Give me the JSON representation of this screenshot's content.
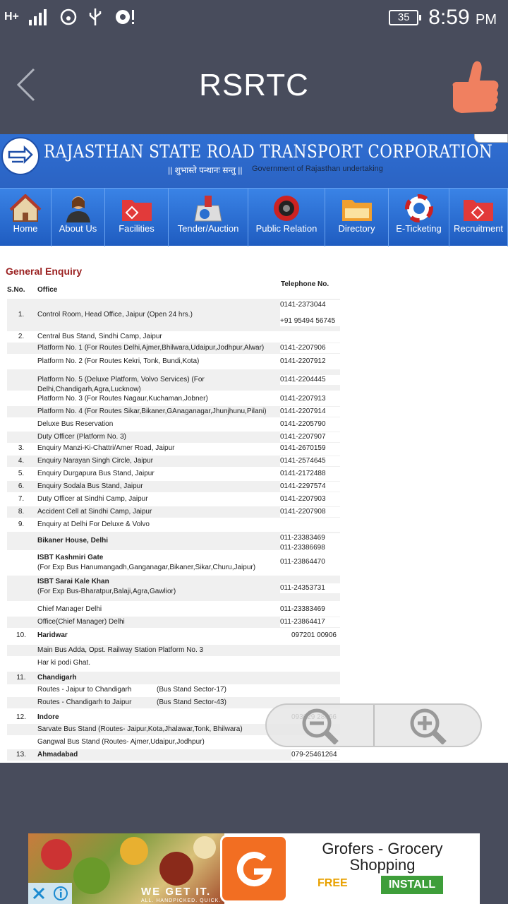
{
  "status_bar": {
    "network": "H+",
    "battery": "35",
    "time": "8:59",
    "ampm": "PM"
  },
  "app_bar": {
    "title": "RSRTC"
  },
  "site": {
    "corp_name": "RAJASTHAN STATE ROAD TRANSPORT CORPORATION",
    "motto": "|| शुभास्ते पन्थानः सन्तु ||",
    "govt": "Government of Rajasthan undertaking",
    "nav": [
      {
        "label": "Home"
      },
      {
        "label": "About Us"
      },
      {
        "label": "Facilities"
      },
      {
        "label": "Tender/Auction"
      },
      {
        "label": "Public Relation"
      },
      {
        "label": "Directory"
      },
      {
        "label": "E-Ticketing"
      },
      {
        "label": "Recruitment"
      }
    ]
  },
  "enquiry": {
    "title": "General Enquiry",
    "headers": {
      "sno": "S.No.",
      "office": "Office",
      "phone": "Telephone No."
    },
    "rows": [
      {
        "sno": "1.",
        "office": "Control Room, Head Office, Jaipur (Open 24 hrs.)",
        "phone": "0141-2373044",
        "phone2": "+91 95494 56745"
      },
      {
        "sno": "2.",
        "office": "Central Bus Stand, Sindhi Camp, Jaipur",
        "phone": ""
      },
      {
        "sno": "",
        "office": "Platform No. 1 (For Routes Delhi,Ajmer,Bhilwara,Udaipur,Jodhpur,Alwar)",
        "phone": "0141-2207906"
      },
      {
        "sno": "",
        "office": "Platform No. 2 (For Routes Kekri, Tonk, Bundi,Kota)",
        "phone": "0141-2207912"
      },
      {
        "sno": "",
        "office": "Platform No. 5 (Deluxe Platform, Volvo Services) (For Delhi,Chandigarh,Agra,Lucknow)",
        "phone": "0141-2204445"
      },
      {
        "sno": "",
        "office": "Platform No. 3 (For Routes Nagaur,Kuchaman,Jobner)",
        "phone": "0141-2207913"
      },
      {
        "sno": "",
        "office": "Platform No. 4 (For Routes Sikar,Bikaner,GAnaganagar,Jhunjhunu,Pilani)",
        "phone": "0141-2207914"
      },
      {
        "sno": "",
        "office": "Deluxe Bus Reservation",
        "phone": "0141-2205790"
      },
      {
        "sno": "",
        "office": "Duty Officer (Platform No. 3)",
        "phone": "0141-2207907"
      },
      {
        "sno": "3.",
        "office": "Enquiry Manzi-Ki-Chattri/Amer Road, Jaipur",
        "phone": "0141-2670159"
      },
      {
        "sno": "4.",
        "office": "Enquiry Narayan Singh Circle, Jaipur",
        "phone": "0141-2574645"
      },
      {
        "sno": "5.",
        "office": "Enquiry Durgapura Bus Stand, Jaipur",
        "phone": "0141-2172488"
      },
      {
        "sno": "6.",
        "office": "Enquiry Sodala Bus Stand, Jaipur",
        "phone": "0141-2297574"
      },
      {
        "sno": "7.",
        "office": "Duty Officer at Sindhi Camp, Jaipur",
        "phone": "0141-2207903"
      },
      {
        "sno": "8.",
        "office": "Accident Cell at Sindhi Camp, Jaipur",
        "phone": "0141-2207908"
      },
      {
        "sno": "9.",
        "office": "Enquiry at Delhi For Deluxe & Volvo",
        "phone": ""
      },
      {
        "sno": "",
        "office": "Bikaner House, Delhi",
        "phone": "011-23383469",
        "phone2": "011-23386698"
      },
      {
        "sno": "",
        "office": "ISBT Kashmiri Gate",
        "office2": "(For Exp Bus Hanumangadh,Ganganagar,Bikaner,Sikar,Churu,Jaipur)",
        "phone": "011-23864470"
      },
      {
        "sno": "",
        "office": "ISBT Sarai Kale Khan",
        "office2": "(For Exp Bus-Bharatpur,Balaji,Agra,Gawlior)",
        "phone": "011-24353731"
      },
      {
        "sno": "",
        "office": "Chief Manager Delhi",
        "phone": "011-23383469"
      },
      {
        "sno": "",
        "office": "Office(Chief Manager) Delhi",
        "phone": "011-23864417"
      },
      {
        "sno": "10.",
        "office": "Haridwar",
        "phone": "097201 00906"
      },
      {
        "sno": "",
        "office": "Main Bus Adda, Opst. Railway Station Platform No. 3",
        "phone": ""
      },
      {
        "sno": "",
        "office": "Har ki podi Ghat.",
        "phone": ""
      },
      {
        "sno": "11.",
        "office": "Chandigarh",
        "phone": ""
      },
      {
        "sno": "",
        "office": "Routes - Jaipur to Chandigarh",
        "office_b": "(Bus Stand Sector-17)",
        "phone": ""
      },
      {
        "sno": "",
        "office": "Routes - Chandigarh to Jaipur",
        "office_b": "(Bus Stand Sector-43)",
        "phone": ""
      },
      {
        "sno": "12.",
        "office": "Indore",
        "phone": "093029 28066"
      },
      {
        "sno": "",
        "office": "Sarvate Bus Stand (Routes- Jaipur,Kota,Jhalawar,Tonk, Bhilwara)",
        "phone": ""
      },
      {
        "sno": "",
        "office": "Gangwal Bus Stand (Routes- Ajmer,Udaipur,Jodhpur)",
        "phone": ""
      },
      {
        "sno": "13.",
        "office": "Ahmadabad",
        "phone": "079-25461264"
      }
    ]
  },
  "ad": {
    "tagline": "WE GET IT.",
    "tagline2": "ALL. HANDPICKED. QUICK.",
    "title": "Grofers - Grocery Shopping",
    "price": "FREE",
    "install": "INSTALL"
  },
  "colors": {
    "chrome": "#484c5c",
    "nav_blue": "#2b63c3",
    "section_title": "#9b2222",
    "thumb": "#f08060",
    "install_green": "#3e9e3a"
  }
}
